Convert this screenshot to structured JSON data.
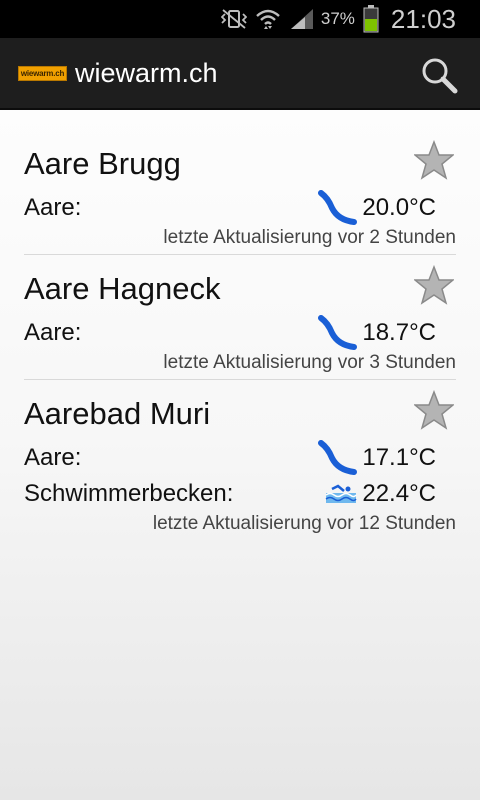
{
  "status_bar": {
    "battery_percent": "37%",
    "time": "21:03",
    "icons": [
      "vibrate-icon",
      "wifi-icon",
      "signal-icon",
      "battery-icon"
    ]
  },
  "action_bar": {
    "logo_text": "wiewarm.ch",
    "title": "wiewarm.ch",
    "search_icon": "search-icon"
  },
  "locations": [
    {
      "name": "Aare Brugg",
      "rows": [
        {
          "label": "Aare:",
          "icon": "river-icon",
          "temp": "20.0°C"
        }
      ],
      "updated": "letzte Aktualisierung vor 2 Stunden"
    },
    {
      "name": "Aare Hagneck",
      "rows": [
        {
          "label": "Aare:",
          "icon": "river-icon",
          "temp": "18.7°C"
        }
      ],
      "updated": "letzte Aktualisierung vor 3 Stunden"
    },
    {
      "name": "Aarebad Muri",
      "rows": [
        {
          "label": "Aare:",
          "icon": "river-icon",
          "temp": "17.1°C"
        },
        {
          "label": "Schwimmerbecken:",
          "icon": "pool-icon",
          "temp": "22.4°C"
        }
      ],
      "updated": "letzte Aktualisierung vor 12 Stunden"
    }
  ],
  "colors": {
    "river": "#1a5fd6",
    "pool": "#2a8fd6",
    "star": "#9a9a9a",
    "battery": "#7ec300",
    "logo_bg": "#f0a000"
  }
}
